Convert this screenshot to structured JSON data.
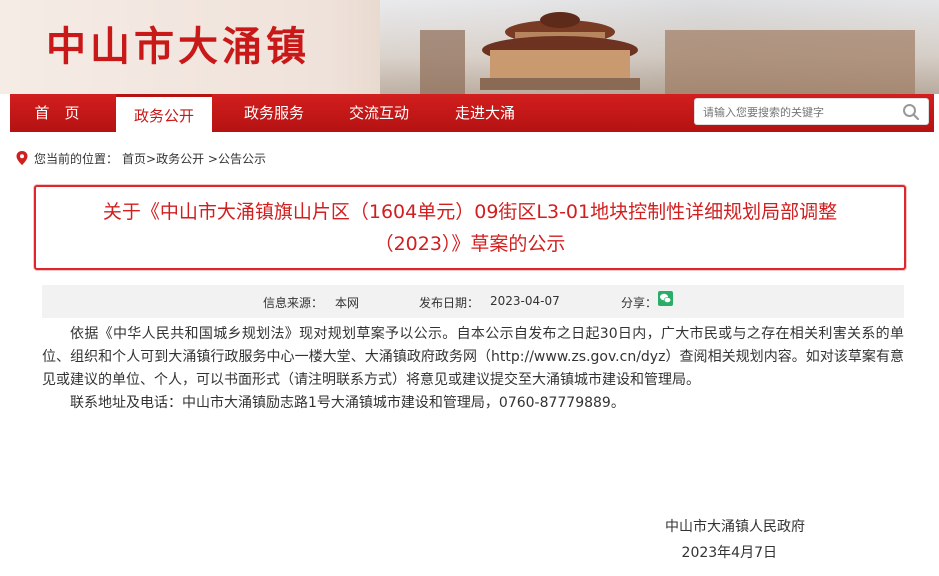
{
  "header": {
    "site_title": "中山市大涌镇"
  },
  "nav": {
    "items": [
      {
        "label": "首　页"
      },
      {
        "label": "政务公开"
      },
      {
        "label": "政务服务"
      },
      {
        "label": "交流互动"
      },
      {
        "label": "走进大涌"
      }
    ],
    "active_index": 1,
    "search_placeholder": "请输入您要搜索的关键字"
  },
  "breadcrumb": {
    "prefix": "您当前的位置：",
    "path": "首页>政务公开 >公告公示"
  },
  "article": {
    "title_line1": "关于《中山市大涌镇旗山片区（1604单元）09街区L3-01地块控制性详细规划局部调整",
    "title_line2": "（2023）》草案的公示",
    "meta": {
      "source_label": "信息来源：",
      "source_value": "本网",
      "date_label": "发布日期：",
      "date_value": "2023-04-07",
      "share_label": "分享："
    },
    "paragraphs": [
      "依据《中华人民共和国城乡规划法》现对规划草案予以公示。自本公示自发布之日起30日内，广大市民或与之存在相关利害关系的单位、组织和个人可到大涌镇行政服务中心一楼大堂、大涌镇政府政务网（http://www.zs.gov.cn/dyz）查阅相关规划内容。如对该草案有意见或建议的单位、个人，可以书面形式（请注明联系方式）将意见或建议提交至大涌镇城市建设和管理局。",
      "联系地址及电话：中山市大涌镇励志路1号大涌镇城市建设和管理局，0760-87779889。"
    ],
    "signature": {
      "org": "中山市大涌镇人民政府",
      "date": "2023年4月7日"
    }
  },
  "colors": {
    "brand_red": "#c81818",
    "title_red": "#d11f1f",
    "wechat_green": "#2aae67"
  }
}
